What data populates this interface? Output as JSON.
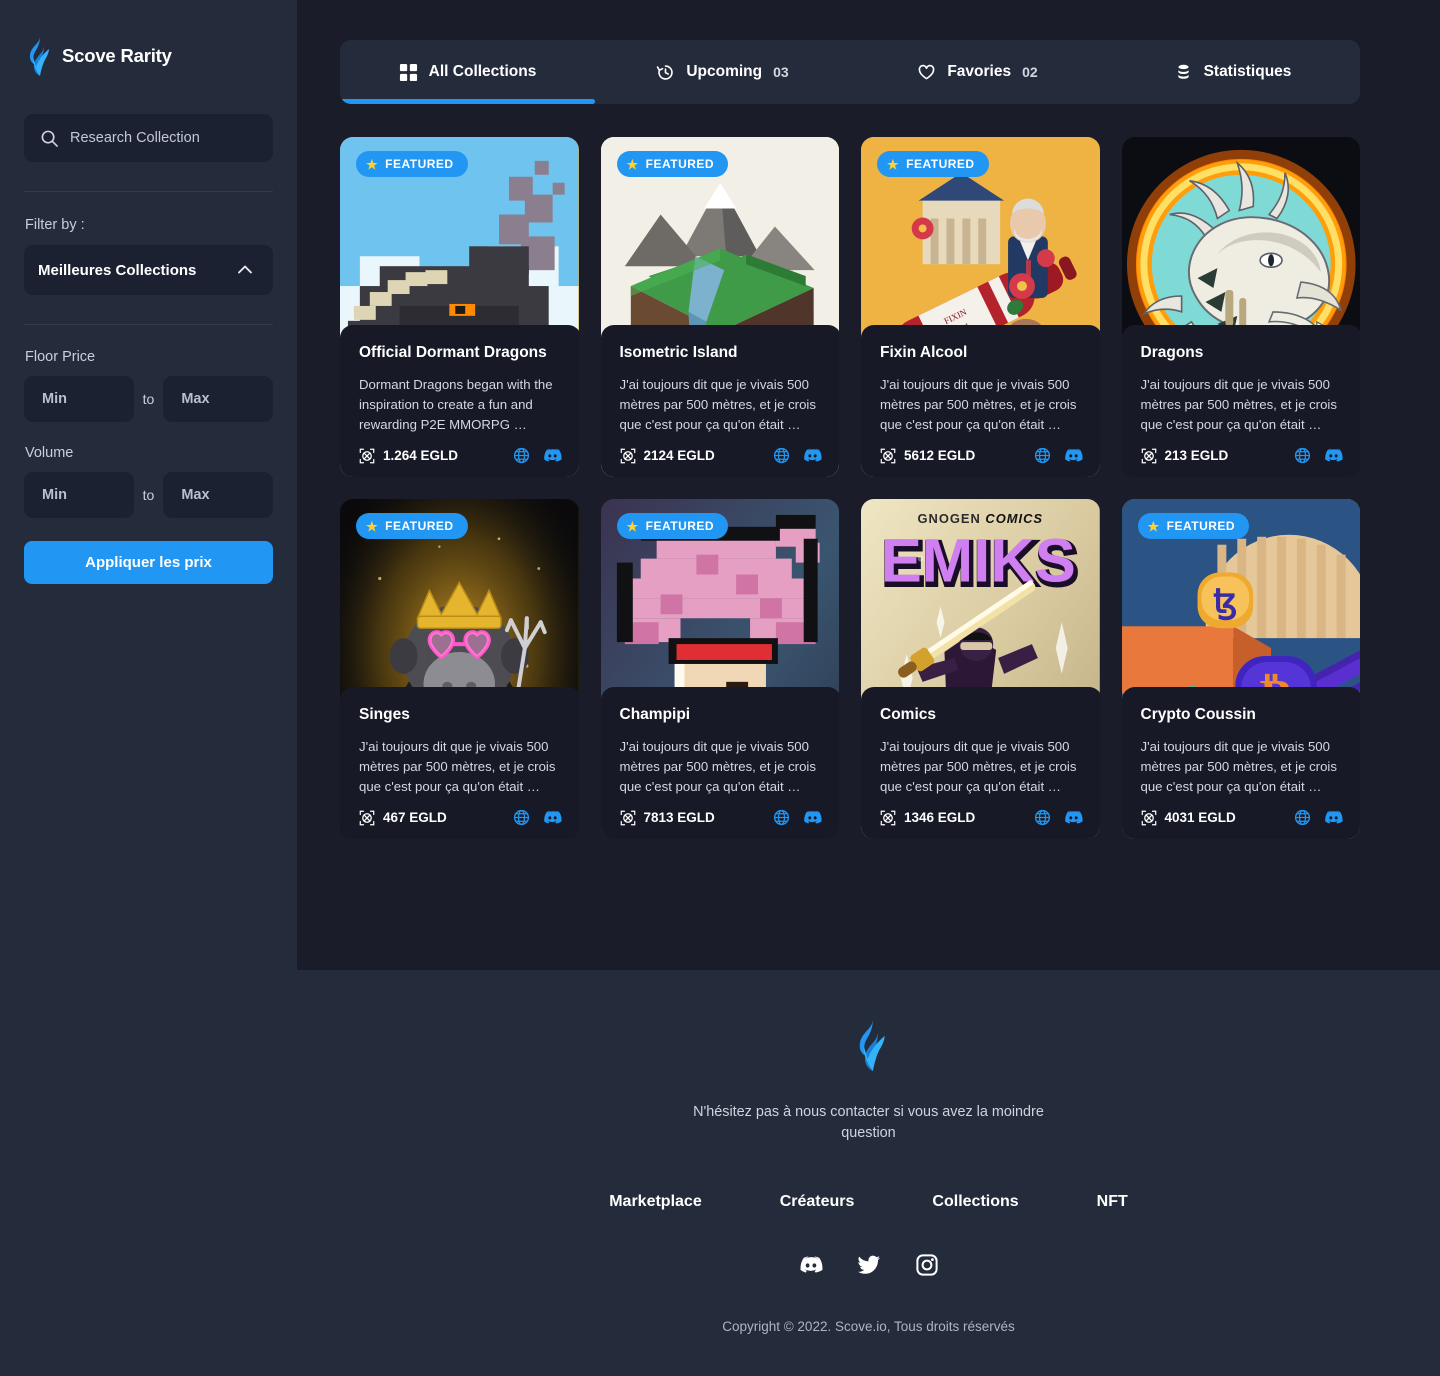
{
  "brand": {
    "name": "Scove Rarity",
    "logo_icon": "flame-logo-icon",
    "accent": "#2196f3"
  },
  "sidebar": {
    "search": {
      "placeholder": "Research Collection",
      "value": "",
      "icon": "search-icon"
    },
    "filter_label": "Filter  by :",
    "select": {
      "value": "Meilleures Collections",
      "icon": "chevron-up-icon"
    },
    "floor_price": {
      "label": "Floor Price",
      "min_placeholder": "Min",
      "max_placeholder": "Max",
      "separator": "to"
    },
    "volume": {
      "label": "Volume",
      "min_placeholder": "Min",
      "max_placeholder": "Max",
      "separator": "to"
    },
    "apply_button": "Appliquer les prix"
  },
  "tabs": [
    {
      "label": "All Collections",
      "count": "",
      "icon": "grid-icon",
      "active": true
    },
    {
      "label": "Upcoming",
      "count": "03",
      "icon": "clock-history-icon",
      "active": false
    },
    {
      "label": "Favories",
      "count": "02",
      "icon": "heart-icon",
      "active": false
    },
    {
      "label": "Statistiques",
      "count": "",
      "icon": "database-icon",
      "active": false
    }
  ],
  "badge_label": "FEATURED",
  "cards": [
    {
      "title": "Official Dormant Dragons",
      "desc": "Dormant Dragons began with the inspiration to create a fun and rewarding P2E MMORPG …",
      "price": "1.264 EGLD",
      "featured": true,
      "art": "pixel-dragon",
      "edge": "#d8a22a"
    },
    {
      "title": "Isometric Island",
      "desc": "J'ai toujours dit que je vivais 500 mètres par 500 mètres, et je crois que c'est pour ça qu'on était …",
      "price": "2124 EGLD",
      "featured": true,
      "art": "isometric-island",
      "edge": "#efeee4"
    },
    {
      "title": "Fixin Alcool",
      "desc": "J'ai toujours dit que je vivais 500 mètres par 500 mètres, et je crois que c'est pour ça qu'on était …",
      "price": "5612 EGLD",
      "featured": true,
      "art": "wine-bottle",
      "edge": "#eab749"
    },
    {
      "title": "Dragons",
      "desc": "J'ai toujours dit que je vivais 500 mètres par 500 mètres, et je crois que c'est pour ça qu'on était …",
      "price": "213 EGLD",
      "featured": false,
      "art": "fire-dragon",
      "edge": "#1b1f2c"
    },
    {
      "title": "Singes",
      "desc": "J'ai toujours dit que je vivais 500 mètres par 500 mètres, et je crois que c'est pour ça qu'on était …",
      "price": "467 EGLD",
      "featured": true,
      "art": "king-ape",
      "edge": "#2a2410"
    },
    {
      "title": "Champipi",
      "desc": "J'ai toujours dit que je vivais 500 mètres par 500 mètres, et je crois que c'est pour ça qu'on était …",
      "price": "7813 EGLD",
      "featured": true,
      "art": "pixel-mushroom",
      "edge": "#2b3040"
    },
    {
      "title": "Comics",
      "desc": "J'ai toujours dit que je vivais 500 mètres par 500 mètres, et je crois que c'est pour ça qu'on était …",
      "price": "1346 EGLD",
      "featured": false,
      "art": "comics-hero",
      "edge": "#9b58c9"
    },
    {
      "title": "Crypto Coussin",
      "desc": "J'ai toujours dit que je vivais 500 mètres par 500 mètres, et je crois que c'est pour ça qu'on était …",
      "price": "4031 EGLD",
      "featured": true,
      "art": "crypto-cushion",
      "edge": "#e2b24a"
    }
  ],
  "footer": {
    "logo_icon": "flame-logo-icon",
    "tagline": "N'hésitez pas à nous contacter si vous avez la moindre question",
    "nav": [
      "Marketplace",
      "Créateurs",
      "Collections",
      "NFT"
    ],
    "socials": [
      "discord-icon",
      "twitter-icon",
      "instagram-icon"
    ],
    "copyright": "Copyright © 2022. Scove.io, Tous droits réservés"
  }
}
